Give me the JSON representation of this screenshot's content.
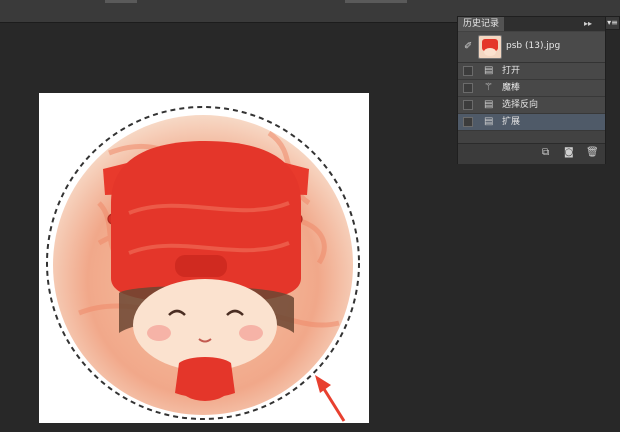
{
  "history_panel": {
    "tab_label": "历史记录",
    "collapse_glyph": "▸▸",
    "menu_glyph": "▾≡",
    "snapshot": {
      "label": "psb (13).jpg",
      "icon": "history-brush-icon"
    },
    "items": [
      {
        "label": "打开",
        "icon": "document-icon",
        "active": false
      },
      {
        "label": "魔棒",
        "icon": "magic-wand-icon",
        "active": false
      },
      {
        "label": "选择反向",
        "icon": "document-icon",
        "active": false
      },
      {
        "label": "扩展",
        "icon": "document-icon",
        "active": true
      }
    ],
    "footer_icons": [
      "new-document-from-state-icon",
      "camera-icon",
      "trash-icon"
    ]
  },
  "colors": {
    "workspace": "#282828",
    "panel": "#424242",
    "active_row": "#4f5a68",
    "arrow": "#e8402f"
  }
}
